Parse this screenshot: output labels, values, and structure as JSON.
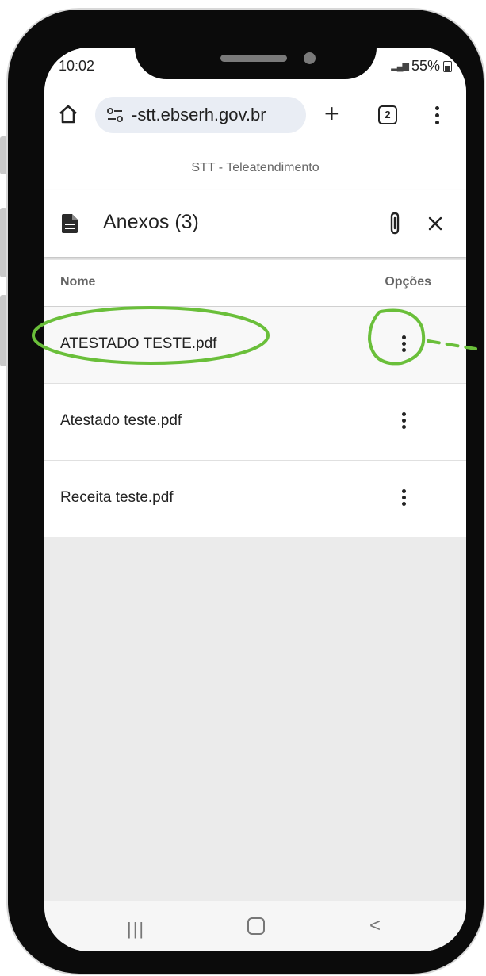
{
  "status_bar": {
    "time": "10:02",
    "battery": "55%"
  },
  "browser": {
    "url": "-stt.ebserh.gov.br",
    "tab_count": "2"
  },
  "app": {
    "title": "STT - Teleatendimento"
  },
  "dialog": {
    "title": "Anexos (3)"
  },
  "table": {
    "headers": {
      "name": "Nome",
      "options": "Opções"
    },
    "rows": [
      {
        "name": "ATESTADO TESTE.pdf"
      },
      {
        "name": "Atestado teste.pdf"
      },
      {
        "name": "Receita teste.pdf"
      }
    ]
  },
  "nav": {
    "recents": "|||"
  },
  "colors": {
    "highlight": "#6abf3a",
    "accent_pill": "#e9edf4",
    "background": "#ebebeb"
  }
}
